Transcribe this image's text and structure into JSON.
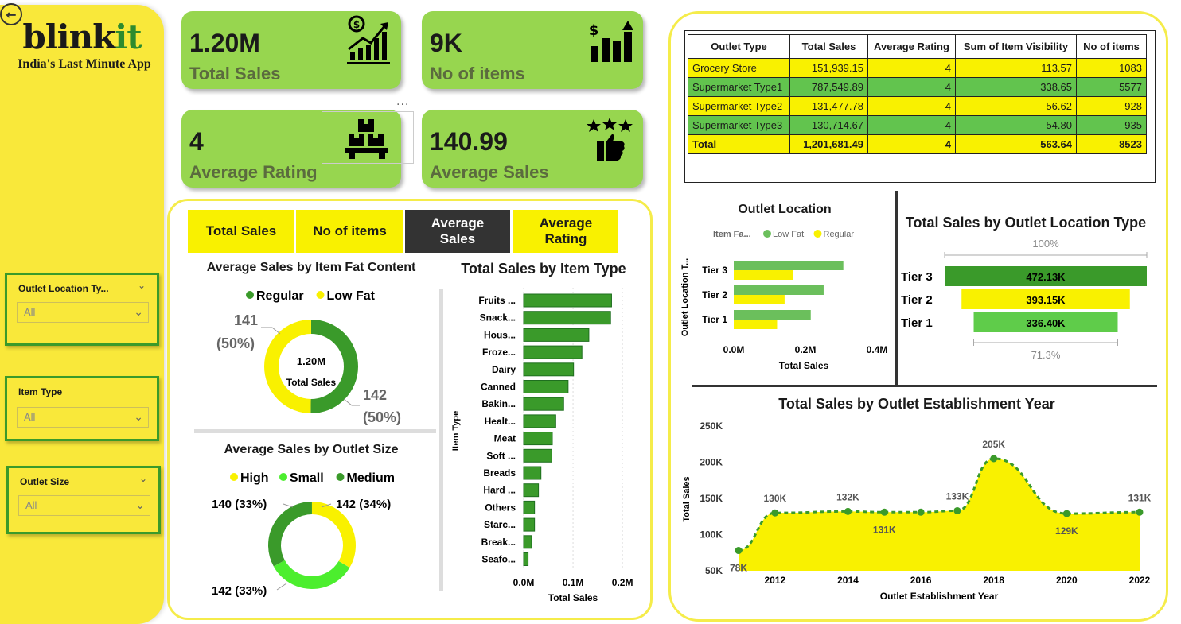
{
  "brand": {
    "name_a": "blink",
    "name_b": "it",
    "tagline": "India's Last Minute App"
  },
  "filters": [
    {
      "title": "Outlet Location Ty...",
      "value": "All"
    },
    {
      "title": "Item Type",
      "value": "All"
    },
    {
      "title": "Outlet Size",
      "value": "All"
    }
  ],
  "kpis": {
    "total_sales": {
      "value": "1.20M",
      "label": "Total Sales"
    },
    "no_of_items": {
      "value": "9K",
      "label": "No of items"
    },
    "avg_rating": {
      "value": "4",
      "label": "Average Rating"
    },
    "avg_sales": {
      "value": "140.99",
      "label": "Average Sales"
    }
  },
  "more_options": "...",
  "metric_buttons": [
    {
      "label": "Total Sales",
      "active": false
    },
    {
      "label": "No of items",
      "active": false
    },
    {
      "label": "Average Sales",
      "active": true
    },
    {
      "label": "Average Rating",
      "active": false
    }
  ],
  "colors": {
    "yellow": "#f9f100",
    "green": "#3a9a2a",
    "light_green": "#97d64f",
    "bright_green": "#4cee2e",
    "mid_green": "#62c44e"
  },
  "table": {
    "headers": [
      "Outlet Type",
      "Total Sales",
      "Average Rating",
      "Sum of Item Visibility",
      "No of items"
    ],
    "rows": [
      [
        "Grocery Store",
        "151,939.15",
        "4",
        "113.57",
        "1083"
      ],
      [
        "Supermarket Type1",
        "787,549.89",
        "4",
        "338.65",
        "5577"
      ],
      [
        "Supermarket Type2",
        "131,477.78",
        "4",
        "56.62",
        "928"
      ],
      [
        "Supermarket Type3",
        "130,714.67",
        "4",
        "54.80",
        "935"
      ]
    ],
    "total": [
      "Total",
      "1,201,681.49",
      "4",
      "563.64",
      "8523"
    ]
  },
  "chart_data": [
    {
      "type": "donut",
      "title": "Average Sales by Item Fat Content",
      "legend": [
        "Regular",
        "Low Fat"
      ],
      "center_value": "1.20M",
      "center_label": "Total Sales",
      "slices": [
        {
          "name": "Regular",
          "value": 142,
          "label": "142",
          "pct": "(50%)",
          "color": "#3a9a2a"
        },
        {
          "name": "Low Fat",
          "value": 141,
          "label": "141",
          "pct": "(50%)",
          "color": "#f9f100"
        }
      ]
    },
    {
      "type": "donut",
      "title": "Average Sales by Outlet Size",
      "legend": [
        "High",
        "Small",
        "Medium"
      ],
      "slices": [
        {
          "name": "High",
          "value": 142,
          "label": "142 (34%)",
          "color": "#f9f100"
        },
        {
          "name": "Small",
          "value": 142,
          "label": "142 (33%)",
          "color": "#4cee2e"
        },
        {
          "name": "Medium",
          "value": 140,
          "label": "140 (33%)",
          "color": "#3a9a2a"
        }
      ]
    },
    {
      "type": "bar",
      "orientation": "horizontal",
      "title": "Total Sales by Item Type",
      "xlabel": "Total Sales",
      "ylabel": "Item Type",
      "xticks": [
        "0.0M",
        "0.1M",
        "0.2M"
      ],
      "xlim": [
        0,
        0.2
      ],
      "categories": [
        "Fruits ...",
        "Snack...",
        "Hous...",
        "Froze...",
        "Dairy",
        "Canned",
        "Bakin...",
        "Healt...",
        "Meat",
        "Soft ...",
        "Breads",
        "Hard ...",
        "Others",
        "Starc...",
        "Break...",
        "Seafo..."
      ],
      "values": [
        0.178,
        0.176,
        0.132,
        0.118,
        0.101,
        0.09,
        0.081,
        0.065,
        0.058,
        0.057,
        0.035,
        0.03,
        0.022,
        0.022,
        0.016,
        0.009
      ]
    },
    {
      "type": "bar",
      "orientation": "horizontal",
      "title": "Outlet Location",
      "legend_title": "Item Fa...",
      "xlabel": "Total Sales",
      "ylabel": "Outlet Location T...",
      "xticks": [
        "0.0M",
        "0.2M",
        "0.4M"
      ],
      "xlim": [
        0,
        0.4
      ],
      "categories": [
        "Tier 3",
        "Tier 2",
        "Tier 1"
      ],
      "series": [
        {
          "name": "Low Fat",
          "color": "#6bbf5c",
          "values": [
            0.306,
            0.251,
            0.215
          ]
        },
        {
          "name": "Regular",
          "color": "#f9f100",
          "values": [
            0.166,
            0.142,
            0.121
          ]
        }
      ]
    },
    {
      "type": "funnel",
      "title": "Total Sales by Outlet Location Type",
      "top_pct": "100%",
      "bottom_pct": "71.3%",
      "categories": [
        "Tier 3",
        "Tier 2",
        "Tier 1"
      ],
      "values": [
        472.13,
        393.15,
        336.4
      ],
      "labels": [
        "472.13K",
        "393.15K",
        "336.40K"
      ],
      "colors": [
        "#3a9a2a",
        "#f9f100",
        "#5fcc4a"
      ]
    },
    {
      "type": "area",
      "title": "Total Sales by Outlet Establishment Year",
      "xlabel": "Outlet Establishment Year",
      "ylabel": "Total Sales",
      "yticks": [
        "50K",
        "100K",
        "150K",
        "200K",
        "250K"
      ],
      "ylim": [
        50,
        250
      ],
      "xticks": [
        "2012",
        "2014",
        "2016",
        "2018",
        "2020",
        "2022"
      ],
      "xlim": [
        2011,
        2022
      ],
      "x": [
        2011,
        2012,
        2014,
        2015,
        2016,
        2017,
        2018,
        2020,
        2022
      ],
      "y": [
        78,
        130,
        132,
        131,
        131,
        133,
        205,
        129,
        131
      ],
      "labels": [
        "78K",
        "130K",
        "132K",
        "131K",
        "",
        "133K",
        "205K",
        "129K",
        "131K"
      ]
    }
  ]
}
